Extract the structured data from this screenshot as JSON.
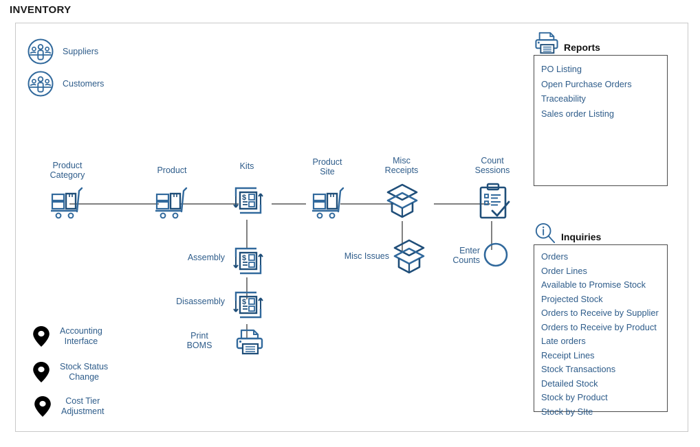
{
  "page": {
    "title": "INVENTORY"
  },
  "colors": {
    "accent_blue": "#2e5c8a",
    "icon_dark_blue": "#1f4e79",
    "icon_mid_blue": "#31699c",
    "connector_gray": "#808080",
    "frame_gray": "#c8c8c8",
    "panel_border": "#4a4a4a",
    "pin_black": "#000000"
  },
  "entities": [
    {
      "label": "Suppliers",
      "icon": "people-circle-icon"
    },
    {
      "label": "Customers",
      "icon": "people-circle-icon"
    }
  ],
  "flow": {
    "main_chain": [
      {
        "label": "Product\nCategory",
        "icon": "hand-truck-icon"
      },
      {
        "label": "Product",
        "icon": "hand-truck-icon"
      },
      {
        "label": "Kits",
        "icon": "kit-bom-icon"
      },
      {
        "label": "Product\nSite",
        "icon": "hand-truck-icon"
      },
      {
        "label": "Misc\nReceipts",
        "icon": "open-box-icon"
      },
      {
        "label": "Count\nSessions",
        "icon": "clipboard-check-icon"
      }
    ],
    "kits_branch": [
      {
        "label": "Assembly",
        "icon": "kit-bom-icon"
      },
      {
        "label": "Disassembly",
        "icon": "kit-bom-icon"
      },
      {
        "label": "Print\nBOMS",
        "icon": "printer-icon"
      }
    ],
    "receipts_branch": [
      {
        "label": "Misc Issues",
        "icon": "open-box-icon"
      }
    ],
    "count_branch": [
      {
        "label": "Enter\nCounts",
        "icon": "circle-icon"
      }
    ]
  },
  "processes": [
    {
      "label": "Accounting\nInterface",
      "icon": "map-pin-icon"
    },
    {
      "label": "Stock Status\nChange",
      "icon": "map-pin-icon"
    },
    {
      "label": "Cost Tier\nAdjustment",
      "icon": "map-pin-icon"
    }
  ],
  "reports": {
    "title": "Reports",
    "icon": "printer-icon",
    "items": [
      "PO Listing",
      "Open Purchase Orders",
      "Traceability",
      "Sales order Listing"
    ]
  },
  "inquiries": {
    "title": "Inquiries",
    "icon": "info-magnifier-icon",
    "items": [
      "Orders",
      "Order Lines",
      "Available to Promise Stock",
      "Projected Stock",
      "Orders to Receive by Supplier",
      "Orders to Receive by Product",
      "Late orders",
      "Receipt Lines",
      "Stock Transactions",
      "Detailed Stock",
      "Stock by Product",
      "Stock by SIte"
    ]
  }
}
